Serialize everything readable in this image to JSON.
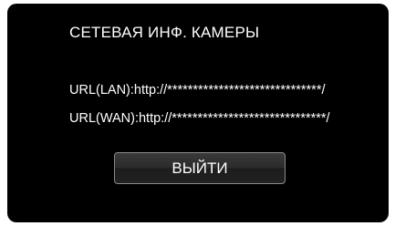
{
  "screen": {
    "title": "СЕТЕВАЯ ИНФ. КАМЕРЫ",
    "url_lan": "URL(LAN):http://******************************/",
    "url_wan": "URL(WAN):http://******************************/",
    "exit_label": "ВЫЙТИ"
  },
  "colors": {
    "background": "#000000",
    "text": "#ffffff",
    "button_border": "#8a8a8a"
  }
}
